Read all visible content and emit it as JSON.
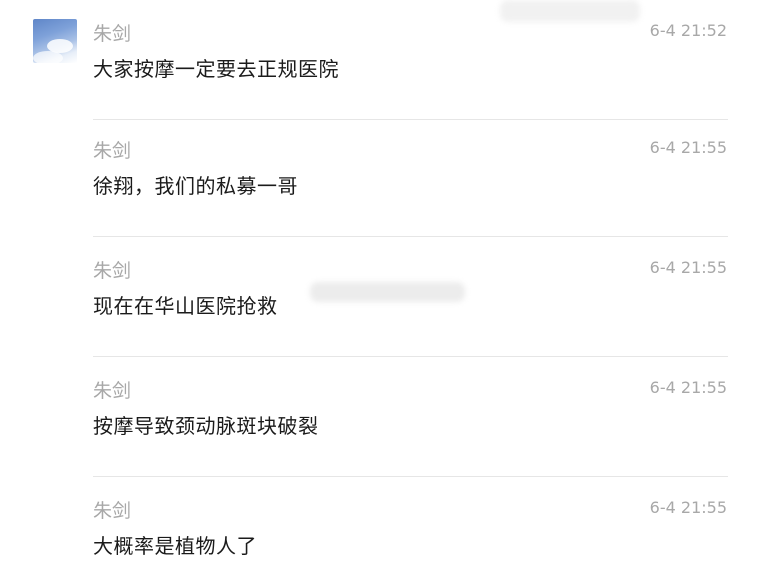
{
  "messages": [
    {
      "sender": "朱剑",
      "time": "6-4 21:52",
      "text": "大家按摩一定要去正规医院",
      "show_avatar": true
    },
    {
      "sender": "朱剑",
      "time": "6-4 21:55",
      "text": "徐翔，我们的私募一哥",
      "show_avatar": false
    },
    {
      "sender": "朱剑",
      "time": "6-4 21:55",
      "text": "现在在华山医院抢救",
      "show_avatar": false
    },
    {
      "sender": "朱剑",
      "time": "6-4 21:55",
      "text": "按摩导致颈动脉斑块破裂",
      "show_avatar": false
    },
    {
      "sender": "朱剑",
      "time": "6-4 21:55",
      "text": "大概率是植物人了",
      "show_avatar": false
    }
  ],
  "colors": {
    "sender": "#a8a8a8",
    "time": "#a8a8a8",
    "text": "#1b1b1b",
    "divider": "#e6e6e6"
  }
}
